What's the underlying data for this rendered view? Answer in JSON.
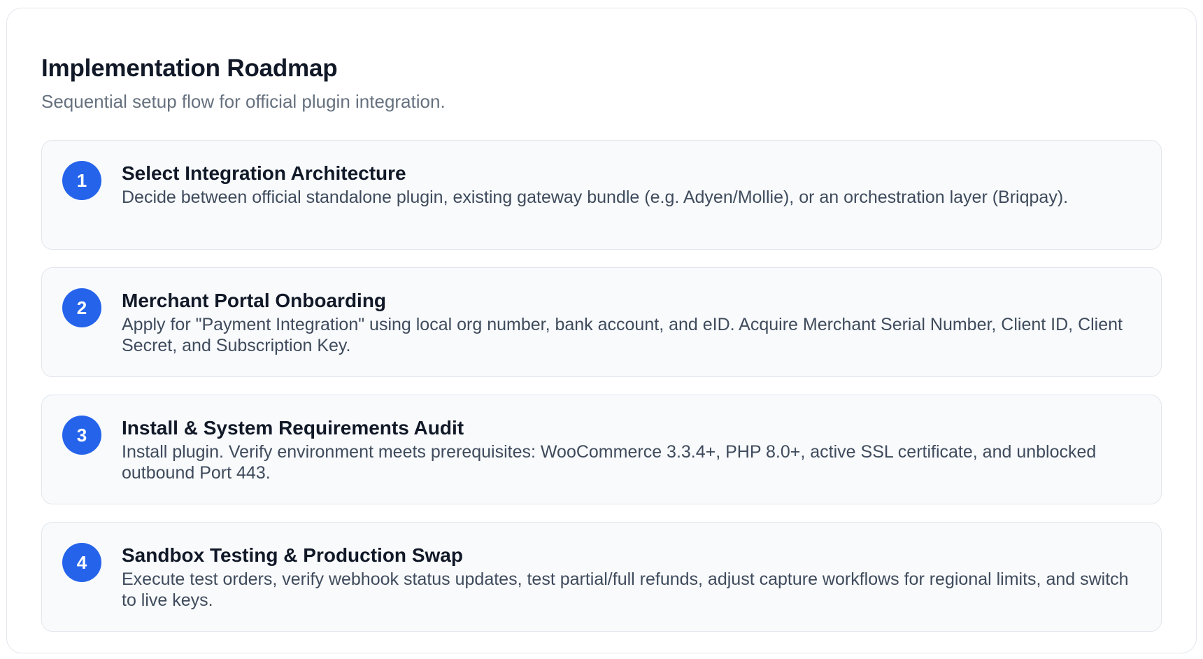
{
  "header": {
    "title": "Implementation Roadmap",
    "subtitle": "Sequential setup flow for official plugin integration."
  },
  "steps": [
    {
      "number": "1",
      "title": "Select Integration Architecture",
      "description": "Decide between official standalone plugin, existing gateway bundle (e.g. Adyen/Mollie), or an orchestration layer (Briqpay)."
    },
    {
      "number": "2",
      "title": "Merchant Portal Onboarding",
      "description": "Apply for \"Payment Integration\" using local org number, bank account, and eID. Acquire Merchant Serial Number, Client ID, Client Secret, and Subscription Key."
    },
    {
      "number": "3",
      "title": "Install & System Requirements Audit",
      "description": "Install plugin. Verify environment meets prerequisites: WooCommerce 3.3.4+, PHP 8.0+, active SSL certificate, and unblocked outbound Port 443."
    },
    {
      "number": "4",
      "title": "Sandbox Testing & Production Swap",
      "description": "Execute test orders, verify webhook status updates, test partial/full refunds, adjust capture workflows for regional limits, and switch to live keys."
    }
  ],
  "colors": {
    "accent": "#2563eb",
    "step_background": "#f8fafc",
    "border": "#e2e6ec"
  }
}
